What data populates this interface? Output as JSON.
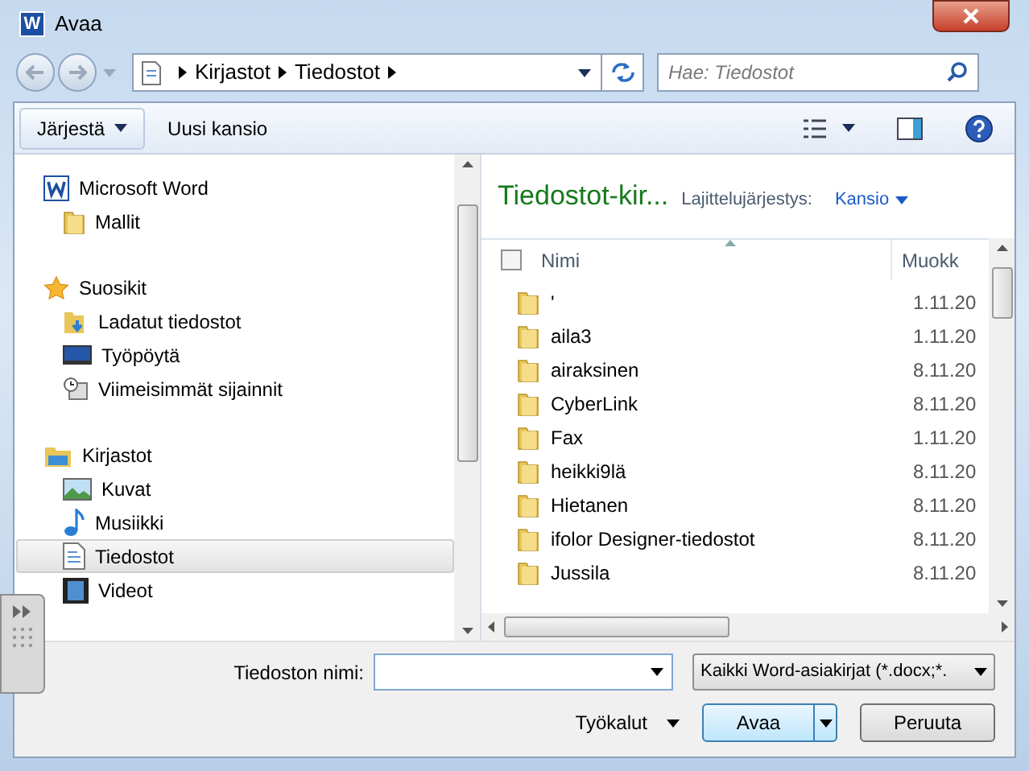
{
  "window": {
    "title": "Avaa",
    "app_icon": "W"
  },
  "address": {
    "crumbs": [
      "Kirjastot",
      "Tiedostot"
    ]
  },
  "search": {
    "placeholder": "Hae: Tiedostot"
  },
  "toolbar": {
    "organize": "Järjestä",
    "new_folder": "Uusi kansio"
  },
  "sidebar": {
    "groups": [
      {
        "label": "Microsoft Word",
        "kind": "word",
        "children": [
          {
            "label": "Mallit",
            "kind": "folder",
            "selected": false
          }
        ]
      },
      {
        "label": "Suosikit",
        "kind": "star",
        "children": [
          {
            "label": "Ladatut tiedostot",
            "kind": "download",
            "selected": false
          },
          {
            "label": "Työpöytä",
            "kind": "desktop",
            "selected": false
          },
          {
            "label": "Viimeisimmät sijainnit",
            "kind": "recent",
            "selected": false
          }
        ]
      },
      {
        "label": "Kirjastot",
        "kind": "library",
        "children": [
          {
            "label": "Kuvat",
            "kind": "pictures",
            "selected": false
          },
          {
            "label": "Musiikki",
            "kind": "music",
            "selected": false
          },
          {
            "label": "Tiedostot",
            "kind": "document",
            "selected": true
          },
          {
            "label": "Videot",
            "kind": "video",
            "selected": false
          }
        ]
      }
    ]
  },
  "library": {
    "title": "Tiedostot-kir...",
    "sort_label": "Lajittelujärjestys:",
    "sort_value": "Kansio"
  },
  "table": {
    "select_all_checked": false,
    "columns": [
      "Nimi",
      "Muokk"
    ],
    "rows": [
      {
        "name": "'",
        "modified": "1.11.20"
      },
      {
        "name": "aila3",
        "modified": "1.11.20"
      },
      {
        "name": "airaksinen",
        "modified": "8.11.20"
      },
      {
        "name": "CyberLink",
        "modified": "8.11.20"
      },
      {
        "name": "Fax",
        "modified": "1.11.20"
      },
      {
        "name": "heikki9lä",
        "modified": "8.11.20"
      },
      {
        "name": "Hietanen",
        "modified": "8.11.20"
      },
      {
        "name": "ifolor Designer-tiedostot",
        "modified": "8.11.20"
      },
      {
        "name": "Jussila",
        "modified": "8.11.20"
      }
    ]
  },
  "footer": {
    "filename_label": "Tiedoston nimi:",
    "filter": "Kaikki Word-asiakirjat (*.docx;*.",
    "tools": "Työkalut",
    "open": "Avaa",
    "cancel": "Peruuta"
  }
}
